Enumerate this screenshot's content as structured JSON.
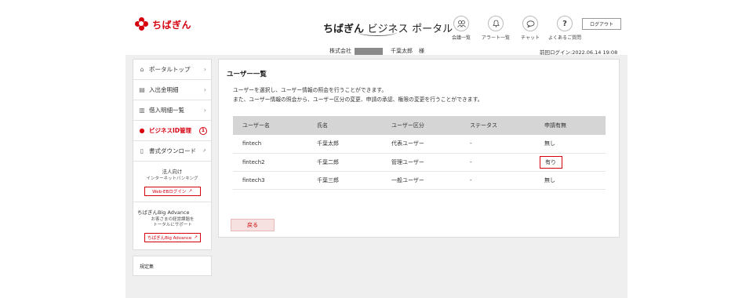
{
  "brand": {
    "logo_text": "ちばぎん",
    "accent": "#d7000f"
  },
  "header": {
    "title_part1": "ちばぎん",
    "title_part2": "ビジネス",
    "title_part3": "ポータル",
    "icons": [
      {
        "name": "contract-list-icon",
        "label": "会議一覧"
      },
      {
        "name": "alert-bell-icon",
        "label": "アラート一覧"
      },
      {
        "name": "chat-bubble-icon",
        "label": "チャット"
      },
      {
        "name": "faq-question-icon",
        "label": "よくあるご質問"
      }
    ],
    "logout_label": "ログアウト",
    "company_prefix": "株式会社",
    "user_name": "千葉太郎",
    "honorific": "様",
    "last_login": "前回ログイン:2022.06.14 19:08"
  },
  "sidebar": {
    "items": [
      {
        "label": "ポータルトップ",
        "icon": "home-icon"
      },
      {
        "label": "入出金明細",
        "icon": "list-icon"
      },
      {
        "label": "借入明細一覧",
        "icon": "chart-icon"
      },
      {
        "label": "ビジネスID管理",
        "icon": "user-icon",
        "badge": "1"
      },
      {
        "label": "書式ダウンロード",
        "icon": "document-icon"
      }
    ],
    "promo1": {
      "title": "法人向け",
      "sub": "インターネットバンキング",
      "button": "Web-EBログイン"
    },
    "promo2": {
      "title": "ちばぎんBig Advance",
      "sub1": "お客さまの経営課題を",
      "sub2": "トータルにサポート",
      "button": "ちばぎんBig Advance"
    },
    "rules_label": "規定集"
  },
  "main": {
    "title": "ユーザー一覧",
    "desc1": "ユーザーを選択し、ユーザー情報の照会を行うことができます。",
    "desc2": "また、ユーザー情報の照会から、ユーザー区分の変更、申請の承認、権限の変更を行うことができます。",
    "columns": [
      "ユーザー名",
      "氏名",
      "ユーザー区分",
      "ステータス",
      "申請有無"
    ],
    "rows": [
      [
        "fintech",
        "千葉太郎",
        "代表ユーザー",
        "-",
        "無し"
      ],
      [
        "fintech2",
        "千葉二郎",
        "管理ユーザー",
        "-",
        "有り"
      ],
      [
        "fintech3",
        "千葉三郎",
        "一般ユーザー",
        "-",
        "無し"
      ]
    ],
    "back_label": "戻る"
  }
}
